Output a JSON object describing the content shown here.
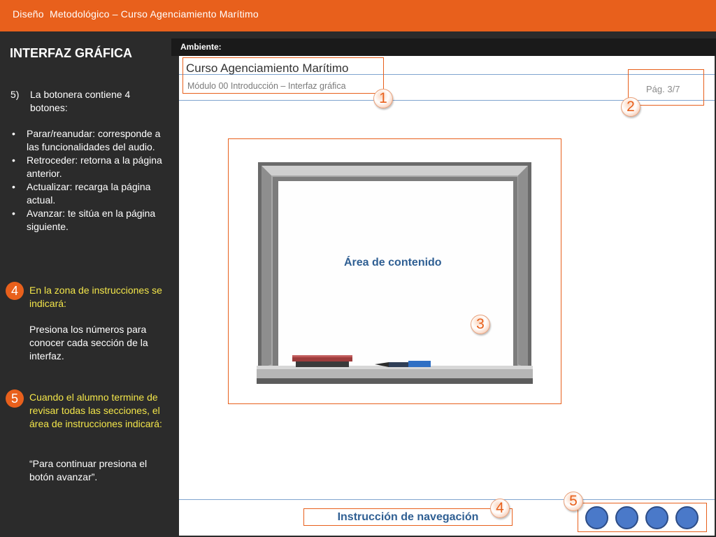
{
  "header": {
    "title": "Diseño  Metodológico – Curso Agenciamiento Marítimo"
  },
  "sidebar": {
    "title": "INTERFAZ GRÁFICA",
    "point5": {
      "number": "5)",
      "text": "La botonera contiene 4 botones:"
    },
    "bullets": [
      "Parar/reanudar: corresponde a las funcionalidades del audio.",
      "Retroceder: retorna a la página anterior.",
      "Actualizar: recarga la página actual.",
      "Avanzar: te sitúa en la página siguiente."
    ],
    "step4": {
      "badge": "4",
      "heading": "En la zona de instrucciones se indicará:",
      "body": "Presiona los números para conocer cada sección de la interfaz."
    },
    "step5": {
      "badge": "5",
      "heading": "Cuando el alumno termine de revisar todas las secciones, el área de instrucciones indicará:",
      "body": "“Para continuar presiona el botón avanzar”."
    }
  },
  "ambient": {
    "label": "Ambiente:"
  },
  "course": {
    "title": "Curso Agenciamiento Marítimo",
    "module": "Módulo 00 Introducción – Interfaz gráfica",
    "page": "Pág. 3/7"
  },
  "content": {
    "label": "Área de contenido"
  },
  "navigation": {
    "instruction": "Instrucción de navegación"
  },
  "callouts": {
    "c1": "1",
    "c2": "2",
    "c3": "3",
    "c4": "4",
    "c5": "5"
  },
  "colors": {
    "accent": "#e8601c",
    "sidebar_bg": "#2b2b2b",
    "link_blue": "#2f5f93",
    "button_blue": "#4a79c9",
    "highlight_yellow": "#f3e64a"
  },
  "nav_buttons": [
    "stop-resume-button",
    "back-button",
    "reload-button",
    "forward-button"
  ]
}
